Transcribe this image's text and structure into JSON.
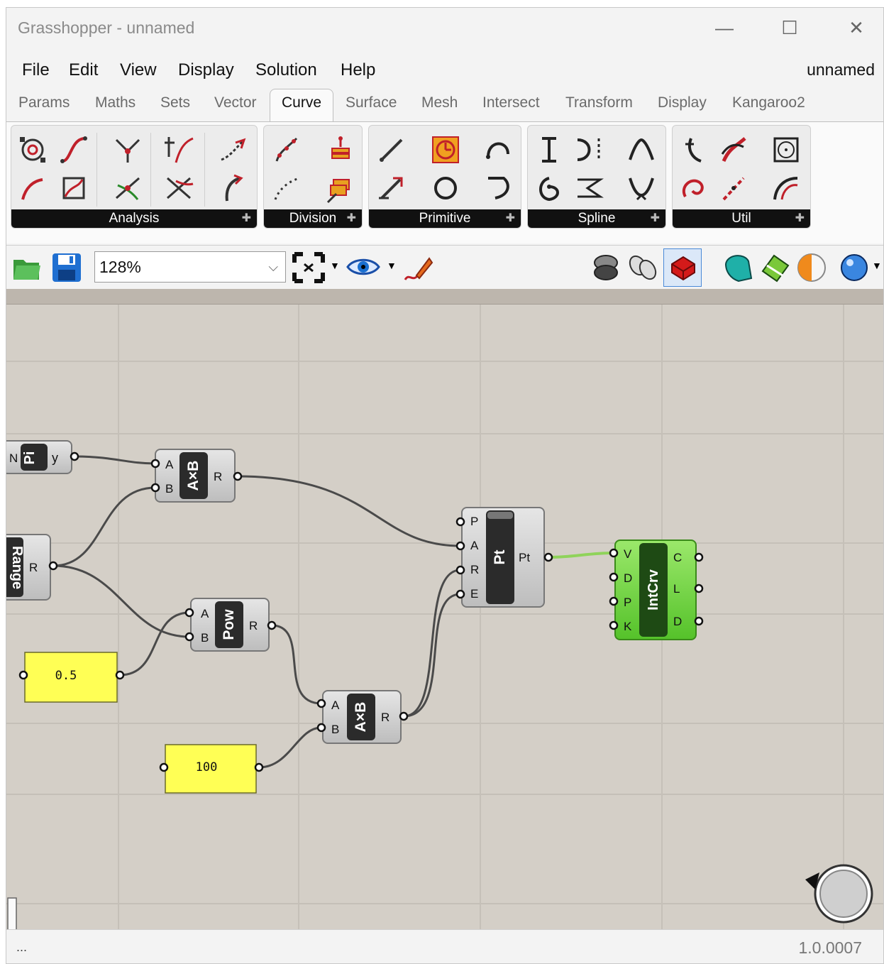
{
  "window": {
    "title": "Grasshopper - unnamed",
    "doc_name": "unnamed",
    "minimize": "—",
    "maximize": "☐",
    "close": "✕"
  },
  "menu": [
    "File",
    "Edit",
    "View",
    "Display",
    "Solution",
    "Help"
  ],
  "tabs": [
    "Params",
    "Maths",
    "Sets",
    "Vector",
    "Curve",
    "Surface",
    "Mesh",
    "Intersect",
    "Transform",
    "Display",
    "Kangaroo2"
  ],
  "active_tab": "Curve",
  "panels": [
    {
      "label": "Analysis"
    },
    {
      "label": "Division"
    },
    {
      "label": "Primitive"
    },
    {
      "label": "Spline"
    },
    {
      "label": "Util"
    }
  ],
  "toolbar": {
    "zoom": "128%",
    "zoom_arrow": "⌵"
  },
  "canvas": {
    "pi": {
      "name": "Pi",
      "in": "N",
      "out": "y"
    },
    "range": {
      "name": "Range",
      "out": "R"
    },
    "mult1": {
      "name": "A×B",
      "a": "A",
      "b": "B",
      "r": "R"
    },
    "pow": {
      "name": "Pow",
      "a": "A",
      "b": "B",
      "r": "R"
    },
    "mult2": {
      "name": "A×B",
      "a": "A",
      "b": "B",
      "r": "R"
    },
    "pt": {
      "name": "Pt",
      "p": "P",
      "a": "A",
      "r": "R",
      "e": "E",
      "out": "Pt"
    },
    "intcrv": {
      "name": "IntCrv",
      "v": "V",
      "d": "D",
      "p": "P",
      "k": "K",
      "c": "C",
      "l": "L",
      "d_out": "D"
    },
    "panel_half": "0.5",
    "panel_hundred": "100"
  },
  "status": {
    "left": "...",
    "version": "1.0.0007"
  }
}
